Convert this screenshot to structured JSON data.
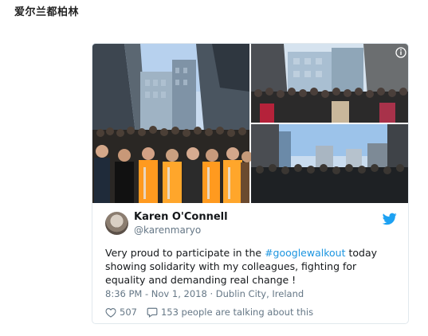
{
  "page": {
    "heading": "爱尔兰都柏林"
  },
  "tweet": {
    "author_name": "Karen O'Connell",
    "author_handle": "@karenmaryo",
    "text_before": "Very proud to participate in the ",
    "hashtag": "#googlewalkout",
    "text_after": " today showing solidarity with my colleagues, fighting for equality and demanding real change !",
    "timestamp": "8:36 PM - Nov 1, 2018",
    "separator": " · ",
    "location": "Dublin City, Ireland",
    "likes": "507",
    "talking": "153 people are talking about this"
  },
  "icons": {
    "bird": "twitter-bird-icon",
    "heart": "heart-icon",
    "comment": "comment-icon",
    "info": "info-icon"
  },
  "colors": {
    "accent": "#1b95e0",
    "muted": "#657786",
    "border": "#e1e8ed"
  }
}
